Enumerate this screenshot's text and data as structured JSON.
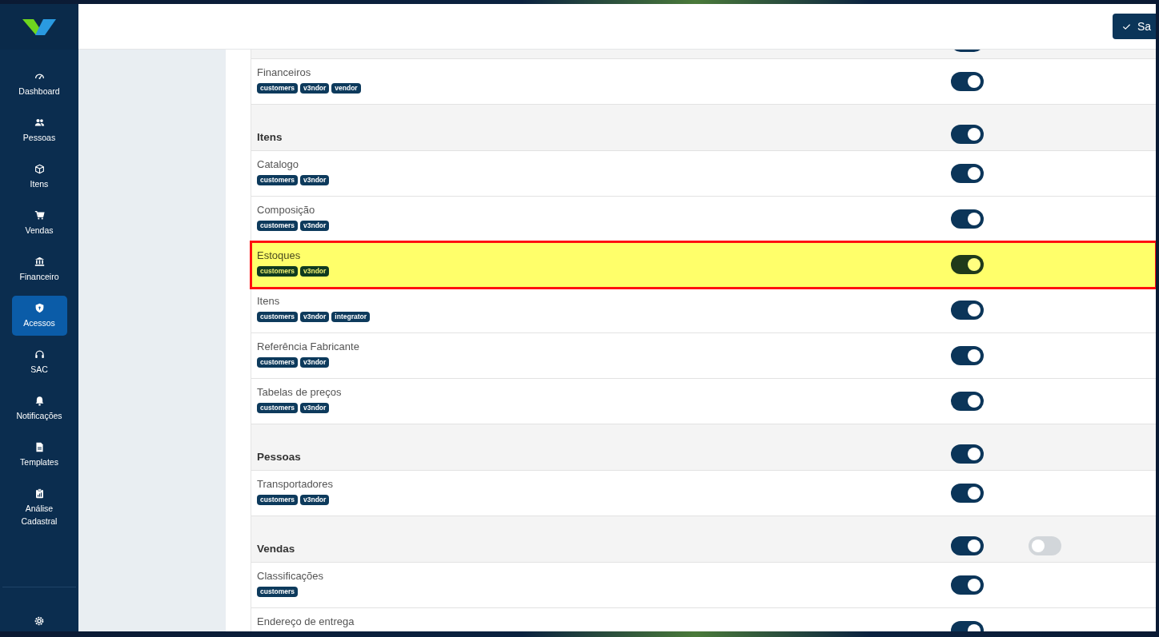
{
  "sidebar": {
    "items": [
      {
        "label": "Dashboard",
        "selected": false
      },
      {
        "label": "Pessoas",
        "selected": false
      },
      {
        "label": "Itens",
        "selected": false
      },
      {
        "label": "Vendas",
        "selected": false
      },
      {
        "label": "Financeiro",
        "selected": false
      },
      {
        "label": "Acessos",
        "selected": true
      },
      {
        "label": "SAC",
        "selected": false
      },
      {
        "label": "Notificações",
        "selected": false
      },
      {
        "label": "Templates",
        "selected": false
      },
      {
        "label": "Análise Cadastral",
        "selected": false
      }
    ]
  },
  "header": {
    "save_button": "Sa"
  },
  "permissions": [
    {
      "kind": "section",
      "highlighted": false,
      "toggles": [
        {
          "on": true
        }
      ]
    },
    {
      "kind": "item",
      "label": "Financeiros",
      "tags": [
        "customers",
        "v3ndor",
        "vendor"
      ],
      "highlighted": false,
      "toggles": [
        {
          "on": true
        }
      ]
    },
    {
      "kind": "section",
      "label": "Itens",
      "highlighted": false,
      "toggles": [
        {
          "on": true
        }
      ]
    },
    {
      "kind": "item",
      "label": "Catalogo",
      "tags": [
        "customers",
        "v3ndor"
      ],
      "highlighted": false,
      "toggles": [
        {
          "on": true
        }
      ]
    },
    {
      "kind": "item",
      "label": "Composição",
      "tags": [
        "customers",
        "v3ndor"
      ],
      "highlighted": false,
      "toggles": [
        {
          "on": true
        }
      ]
    },
    {
      "kind": "item",
      "label": "Estoques",
      "tags": [
        "customers",
        "v3ndor"
      ],
      "highlighted": true,
      "toggles": [
        {
          "on": true
        }
      ]
    },
    {
      "kind": "item",
      "label": "Itens",
      "tags": [
        "customers",
        "v3ndor",
        "integrator"
      ],
      "highlighted": false,
      "toggles": [
        {
          "on": true
        }
      ]
    },
    {
      "kind": "item",
      "label": "Referência Fabricante",
      "tags": [
        "customers",
        "v3ndor"
      ],
      "highlighted": false,
      "toggles": [
        {
          "on": true
        }
      ]
    },
    {
      "kind": "item",
      "label": "Tabelas de preços",
      "tags": [
        "customers",
        "v3ndor"
      ],
      "highlighted": false,
      "toggles": [
        {
          "on": true
        }
      ]
    },
    {
      "kind": "section",
      "label": "Pessoas",
      "highlighted": false,
      "toggles": [
        {
          "on": true
        }
      ]
    },
    {
      "kind": "item",
      "label": "Transportadores",
      "tags": [
        "customers",
        "v3ndor"
      ],
      "highlighted": false,
      "toggles": [
        {
          "on": true
        }
      ]
    },
    {
      "kind": "section",
      "label": "Vendas",
      "highlighted": false,
      "toggles": [
        {
          "on": true
        },
        {
          "on": false
        }
      ]
    },
    {
      "kind": "item",
      "label": "Classificações",
      "tags": [
        "customers"
      ],
      "highlighted": false,
      "toggles": [
        {
          "on": true
        }
      ]
    },
    {
      "kind": "item",
      "label": "Endereço de entrega",
      "highlighted": false,
      "toggles": [
        {
          "on": true
        }
      ]
    }
  ]
}
